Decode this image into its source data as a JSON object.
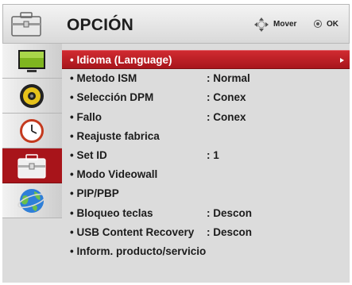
{
  "header": {
    "title": "OPCIÓN",
    "move_hint": "Mover",
    "ok_hint": "OK"
  },
  "sidebar": {
    "items": [
      {
        "icon": "tv-screen-icon",
        "active": false
      },
      {
        "icon": "speaker-icon",
        "active": false
      },
      {
        "icon": "clock-icon",
        "active": false
      },
      {
        "icon": "toolbox-icon",
        "active": true
      },
      {
        "icon": "globe-icon",
        "active": false
      }
    ]
  },
  "menu": {
    "items": [
      {
        "label": "• Idioma (Language)",
        "value": "",
        "selected": true
      },
      {
        "label": "• Metodo ISM",
        "value": ": Normal"
      },
      {
        "label": "• Selección DPM",
        "value": ": Conex"
      },
      {
        "label": "• Fallo",
        "value": ": Conex"
      },
      {
        "label": "• Reajuste fabrica",
        "value": ""
      },
      {
        "label": "• Set ID",
        "value": ": 1"
      },
      {
        "label": "• Modo Videowall",
        "value": ""
      },
      {
        "label": "• PIP/PBP",
        "value": ""
      },
      {
        "label": "• Bloqueo teclas",
        "value": ": Descon"
      },
      {
        "label": "• USB Content Recovery",
        "value": ": Descon"
      },
      {
        "label": "• Inform. producto/servicio",
        "value": ""
      }
    ]
  },
  "colors": {
    "accent_red": "#b8181e",
    "panel_gray": "#dcdcdc"
  }
}
